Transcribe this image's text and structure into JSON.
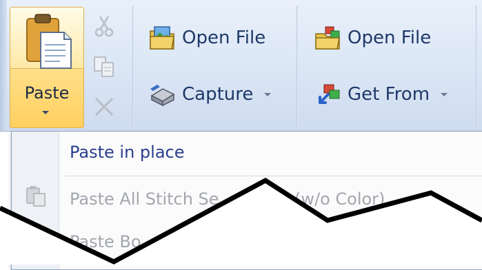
{
  "ribbon": {
    "clipboard": {
      "paste_label": "Paste"
    },
    "group1": {
      "open_file_label": "Open File",
      "capture_label": "Capture"
    },
    "group2": {
      "open_file_label": "Open File",
      "get_from_label": "Get From"
    }
  },
  "paste_menu": {
    "items": [
      {
        "label": "Paste in place",
        "enabled": true
      },
      {
        "label": "Paste All Stitch Se",
        "enabled": false
      },
      {
        "label": "(w/o Color)",
        "enabled": false
      },
      {
        "label": "Paste Bo",
        "enabled": false
      }
    ]
  },
  "colors": {
    "enabled_text": "#2a3f8a",
    "disabled_text": "#a3a7ad",
    "paste_highlight": "#ffd060",
    "ribbon_bg": "#dde8f6"
  },
  "icons": {
    "paste": "clipboard-paste-icon",
    "cut": "scissors-icon",
    "copy": "copy-icon",
    "delete": "x-delete-icon",
    "open_file_1": "folder-image-icon",
    "capture": "scanner-icon",
    "open_file_2": "folder-network-icon",
    "get_from": "network-arrow-icon",
    "paste_all": "paste-stitch-icon"
  }
}
